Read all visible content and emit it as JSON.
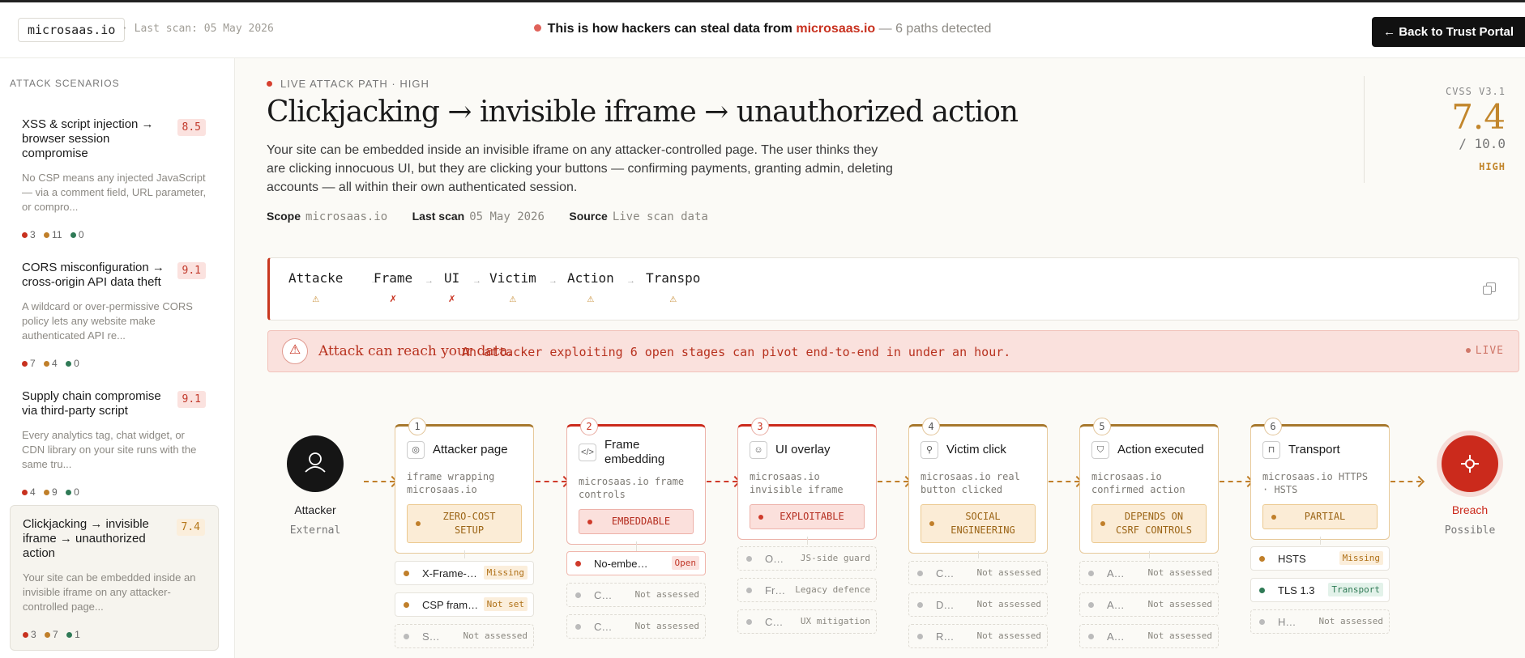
{
  "topbar": {
    "domain": "microsaas.io",
    "last_scan": "· Last scan: 05 May 2026",
    "headline_pre": "This is how hackers can steal data from",
    "headline_domain": "microsaas.io",
    "headline_paths": "— 6 paths detected",
    "back_button": "← Back to Trust Portal"
  },
  "sidebar": {
    "heading": "ATTACK SCENARIOS",
    "scenarios": [
      {
        "title": "XSS & script injection → browser session compromise",
        "score": "8.5",
        "desc": "No CSP means any injected JavaScript — via a comment field, URL parameter, or compro...",
        "red": "3",
        "amber": "11",
        "green": "0"
      },
      {
        "title": "CORS misconfiguration → cross-origin API data theft",
        "score": "9.1",
        "desc": "A wildcard or over-permissive CORS policy lets any website make authenticated API re...",
        "red": "7",
        "amber": "4",
        "green": "0"
      },
      {
        "title": "Supply chain compromise via third-party script",
        "score": "9.1",
        "desc": "Every analytics tag, chat widget, or CDN library on your site runs with the same tru...",
        "red": "4",
        "amber": "9",
        "green": "0"
      },
      {
        "title": "Clickjacking → invisible iframe → unauthorized action",
        "score": "7.4",
        "desc": "Your site can be embedded inside an invisible iframe on any attacker-controlled page...",
        "red": "3",
        "amber": "7",
        "green": "1"
      }
    ]
  },
  "main": {
    "eyebrow": "LIVE ATTACK PATH · HIGH",
    "title": "Clickjacking → invisible iframe → unauthorized action",
    "subtitle": "Your site can be embedded inside an invisible iframe on any attacker-controlled page. The user thinks they are clicking innocuous UI, but they are clicking your buttons — confirming payments, granting admin, deleting accounts — all within their own authenticated session.",
    "meta": {
      "scope_k": "Scope",
      "scope_v": "microsaas.io",
      "scan_k": "Last scan",
      "scan_v": "05 May 2026",
      "source_k": "Source",
      "source_v": "Live scan data"
    },
    "cvss": {
      "label": "CVSS V3.1",
      "score": "7.4",
      "max": "/ 10.0",
      "severity": "HIGH"
    }
  },
  "stagebar": {
    "stages": [
      {
        "name": "Attacke",
        "status": "⚠"
      },
      {
        "name": "Frame",
        "status": "✗"
      },
      {
        "name": "UI",
        "status": "✗"
      },
      {
        "name": "Victim",
        "status": "⚠"
      },
      {
        "name": "Action",
        "status": "⚠"
      },
      {
        "name": "Transpo",
        "status": "⚠"
      }
    ],
    "arrow": "→"
  },
  "alert": {
    "icon": "⚠",
    "title": "Attack can reach your data.",
    "text": "An attacker exploiting 6 open stages can pivot end-to-end in under an hour.",
    "live": "LIVE"
  },
  "pipeline": {
    "start": {
      "name": "Attacker",
      "sub": "External",
      "icon": "user-icon"
    },
    "end": {
      "name": "Breach",
      "sub": "Possible",
      "icon": "crosshair-icon"
    },
    "cards": [
      {
        "num": "1",
        "title": "Attacker page",
        "desc": "iframe wrapping microsaas.io",
        "pill": "ZERO-COST SETUP",
        "icon": "globe-icon"
      },
      {
        "num": "2",
        "title": "Frame embedding",
        "desc": "microsaas.io frame controls",
        "pill": "EMBEDDABLE",
        "icon": "code-icon"
      },
      {
        "num": "3",
        "title": "UI overlay",
        "desc": "microsaas.io invisible iframe",
        "pill": "EXPLOITABLE",
        "icon": "user-icon"
      },
      {
        "num": "4",
        "title": "Victim click",
        "desc": "microsaas.io real button clicked",
        "pill": "SOCIAL ENGINEERING",
        "icon": "link-icon"
      },
      {
        "num": "5",
        "title": "Action executed",
        "desc": "microsaas.io confirmed action",
        "pill": "DEPENDS ON CSRF CONTROLS",
        "icon": "shield-icon"
      },
      {
        "num": "6",
        "title": "Transport",
        "desc": "microsaas.io HTTPS · HSTS",
        "pill": "PARTIAL",
        "icon": "lock-icon"
      }
    ],
    "controls": [
      [
        {
          "label": "X-Frame-Options",
          "tag": "Missing"
        },
        {
          "label": "CSP frame-ancestors",
          "tag": "Not set"
        },
        {
          "label": "SameSite",
          "tag": "Not assessed"
        }
      ],
      [
        {
          "label": "No-embed enforcement",
          "tag": "Open"
        },
        {
          "label": "COOP",
          "tag": "Not assessed"
        },
        {
          "label": "CDN",
          "tag": "Not assessed"
        }
      ],
      [
        {
          "label": "Opacity",
          "tag": "JS-side guard"
        },
        {
          "label": "Frame busting",
          "tag": "Legacy defence"
        },
        {
          "label": "Cover",
          "tag": "UX mitigation"
        }
      ],
      [
        {
          "label": "CSRF",
          "tag": "Not assessed"
        },
        {
          "label": "Double-click",
          "tag": "Not assessed"
        },
        {
          "label": "Re-auth",
          "tag": "Not assessed"
        }
      ],
      [
        {
          "label": "Action confirm",
          "tag": "Not assessed"
        },
        {
          "label": "Action log",
          "tag": "Not assessed"
        },
        {
          "label": "Anomaly",
          "tag": "Not assessed"
        }
      ],
      [
        {
          "label": "HSTS",
          "tag": "Missing"
        },
        {
          "label": "TLS 1.3",
          "tag": "Transport"
        },
        {
          "label": "HSTS preload",
          "tag": "Not assessed"
        }
      ]
    ]
  },
  "colors": {
    "red": "#c8311f",
    "amber": "#c07f2a",
    "green": "#2f7a56",
    "dark": "#111111"
  }
}
